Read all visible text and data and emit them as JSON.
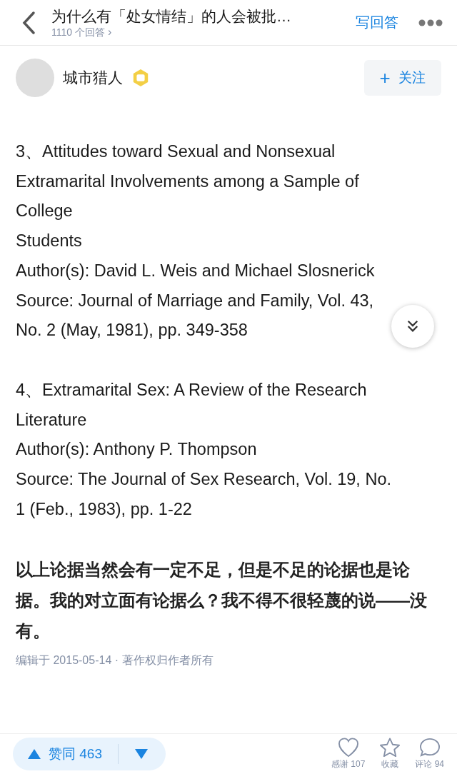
{
  "header": {
    "title": "为什么有「处女情结」的人会被批…",
    "answer_count": "1110 个回答",
    "answer_count_arrow": "›",
    "write_answer": "写回答"
  },
  "author": {
    "name": "城市猎人",
    "follow_label": "关注",
    "follow_sign": "+"
  },
  "blocks": [
    {
      "kind": "reference",
      "lines": [
        "3、Attitudes toward Sexual and Nonsexual",
        "Extramarital Involvements among a Sample of",
        "College",
        "Students",
        "Author(s): David L. Weis and Michael Slosnerick",
        "Source: Journal of Marriage and Family, Vol. 43,",
        "No. 2 (May, 1981), pp. 349-358"
      ]
    },
    {
      "kind": "reference",
      "lines": [
        "4、Extramarital Sex: A Review of the Research",
        "Literature",
        "Author(s): Anthony P. Thompson",
        "Source: The Journal of Sex Research, Vol. 19, No.",
        "1 (Feb., 1983), pp. 1-22"
      ]
    },
    {
      "kind": "paragraph",
      "text": "以上论据当然会有一定不足，但是不足的论据也是论据。我的对立面有论据么？我不得不很轻蔑的说——没有。"
    }
  ],
  "edit_note": "编辑于 2015-05-14 · 著作权归作者所有",
  "footer": {
    "upvote": "赞同 463",
    "actions": [
      {
        "kind": "heart",
        "label": "感谢 107"
      },
      {
        "kind": "star",
        "label": "收藏"
      },
      {
        "kind": "comment",
        "label": "评论 94"
      }
    ]
  }
}
